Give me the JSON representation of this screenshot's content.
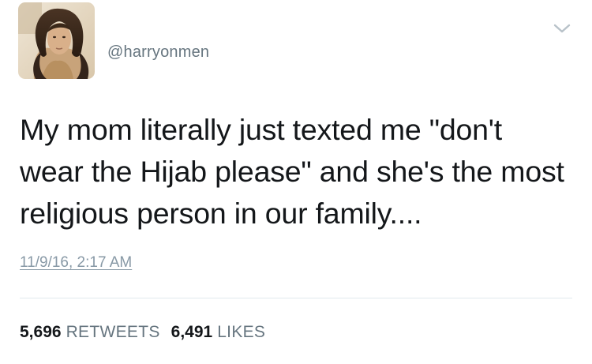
{
  "tweet": {
    "handle": "@harryonmen",
    "text": "My mom literally just texted me \"don't\nwear the Hijab please\" and she's the most\nreligious person in our family....",
    "timestamp": "11/9/16, 2:17 AM",
    "retweets": {
      "count": "5,696",
      "label": "RETWEETS"
    },
    "likes": {
      "count": "6,491",
      "label": "LIKES"
    }
  },
  "icons": {
    "menu": "chevron-down-icon"
  },
  "colors": {
    "text": "#14171a",
    "secondary": "#66757f",
    "timestamp": "#8899a6",
    "divider": "#e1e8ed",
    "caret": "#b8c2c9"
  }
}
